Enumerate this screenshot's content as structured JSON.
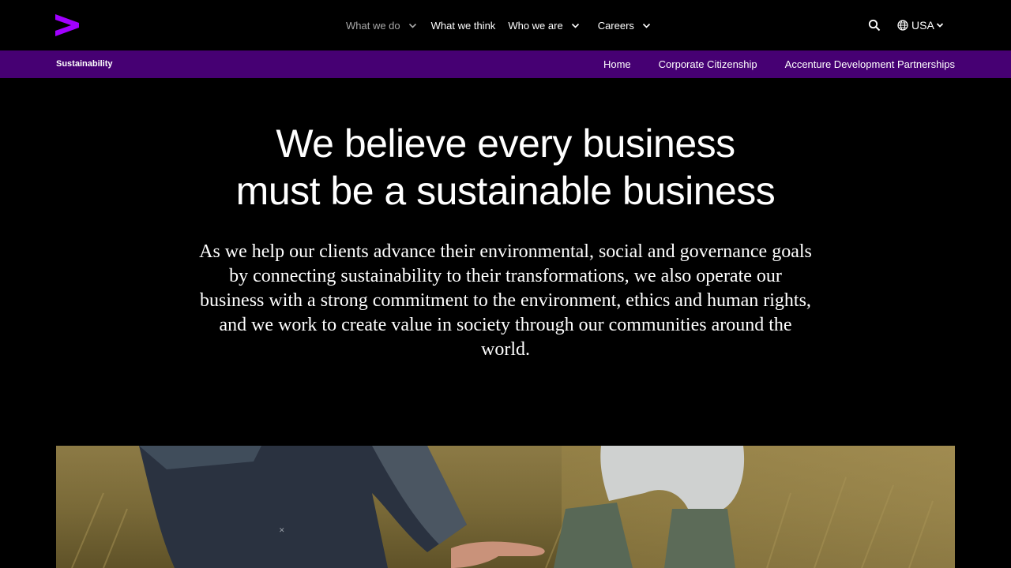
{
  "colors": {
    "accent": "#a100ff",
    "subnav_bg": "#460073",
    "background": "#000000",
    "text": "#ffffff",
    "dim_text": "#a8a8a8"
  },
  "header": {
    "logo_icon": "accenture-greater-than-logo",
    "nav": [
      {
        "label": "What we do",
        "has_dropdown": true
      },
      {
        "label": "What we think",
        "has_dropdown": false
      },
      {
        "label": "Who we are",
        "has_dropdown": true
      },
      {
        "label": "Careers",
        "has_dropdown": true
      }
    ],
    "search_icon": "search-icon",
    "locale": {
      "label": "USA",
      "icon": "globe-icon"
    }
  },
  "subnav": {
    "title": "Sustainability",
    "links": [
      "Home",
      "Corporate Citizenship",
      "Accenture Development Partnerships"
    ]
  },
  "hero": {
    "title_line1": "We believe every business",
    "title_line2": "must be a sustainable business",
    "body_lines": [
      "As we help our clients advance their environmental, social and governance goals",
      "by connecting sustainability to their transformations, we also operate our",
      "business with a strong commitment to the environment, ethics and human rights,",
      "and we work to create value in society through our communities around the",
      "world."
    ]
  }
}
